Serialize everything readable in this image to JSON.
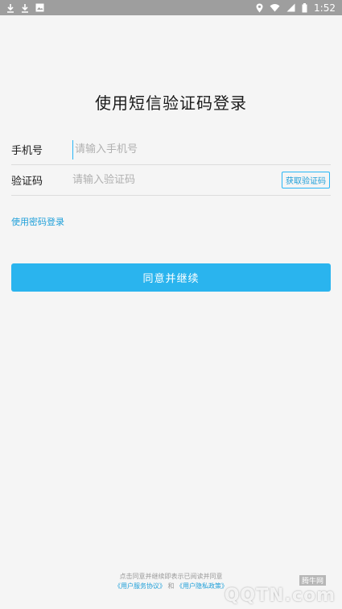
{
  "status_bar": {
    "time": "1:52",
    "left_icons": [
      "download-icon",
      "download-icon",
      "photo-icon"
    ],
    "right_icons": [
      "location-icon",
      "wifi-icon",
      "signal-icon",
      "battery-icon"
    ]
  },
  "title": "使用短信验证码登录",
  "phone_row": {
    "label": "手机号",
    "placeholder": "请输入手机号"
  },
  "code_row": {
    "label": "验证码",
    "placeholder": "请输入验证码",
    "get_code_label": "获取验证码"
  },
  "password_login_link": "使用密码登录",
  "agree_button": "同意并继续",
  "footer": {
    "line1": "点击同意并继续即表示已阅读并同意",
    "user_agreement": "《用户服务协议》",
    "and": "和",
    "privacy_policy": "《用户隐私政策》"
  },
  "watermark": {
    "tag": "腾牛网",
    "logo": "QQTN.com"
  },
  "colors": {
    "accent": "#2ab4ee",
    "link": "#1e9fd9",
    "status_bar": "#9e9e9e"
  }
}
